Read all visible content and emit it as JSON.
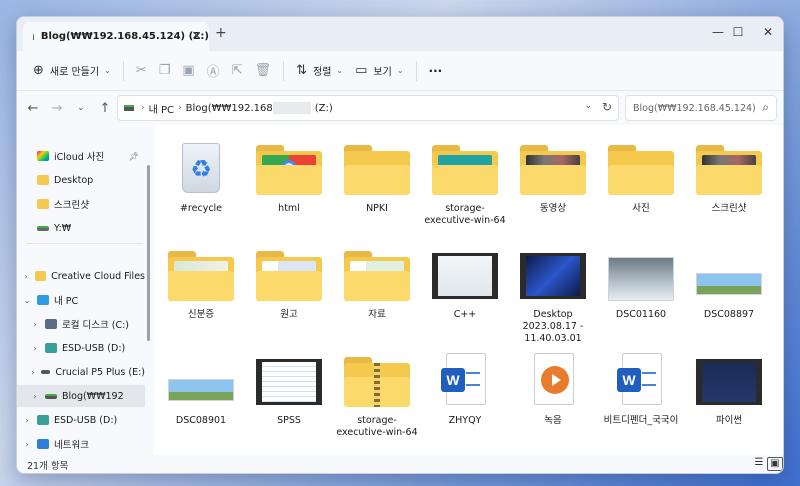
{
  "tab": {
    "title": "Blog(₩₩192.168.45.124) (Z:)",
    "close": "✕",
    "new_tab": "+"
  },
  "window_controls": {
    "minimize": "—",
    "maximize": "☐",
    "close": "✕"
  },
  "toolbar": {
    "new_label": "새로 만들기",
    "sort_label": "정렬",
    "view_label": "보기",
    "more": "···"
  },
  "address": {
    "segments": [
      "내 PC",
      "Blog(₩₩192.168",
      "(Z:)"
    ]
  },
  "search": {
    "placeholder": "Blog(₩₩192.168.45.124) (..."
  },
  "sidebar": {
    "quick": [
      "iCloud 사진",
      "Desktop",
      "스크린샷",
      "Y:₩"
    ],
    "tree": [
      "Creative Cloud Files",
      "내 PC",
      "로컬 디스크 (C:)",
      "ESD-USB (D:)",
      "Crucial P5 Plus (E:)",
      "Blog(₩₩192",
      "ESD-USB (D:)",
      "네트워크"
    ]
  },
  "items": [
    {
      "label": "#recycle",
      "kind": "recycle"
    },
    {
      "label": "html",
      "kind": "folder",
      "preview": "chrome"
    },
    {
      "label": "NPKI",
      "kind": "folder"
    },
    {
      "label": "storage-executive-win-64",
      "kind": "folder",
      "preview": "app"
    },
    {
      "label": "동영상",
      "kind": "folder",
      "preview": "dark"
    },
    {
      "label": "사진",
      "kind": "folder"
    },
    {
      "label": "스크린샷",
      "kind": "folder",
      "preview": "dark"
    },
    {
      "label": "신분증",
      "kind": "folder",
      "preview": "card"
    },
    {
      "label": "원고",
      "kind": "folder",
      "preview": "word"
    },
    {
      "label": "자료",
      "kind": "folder",
      "preview": "excel"
    },
    {
      "label": "C++",
      "kind": "video",
      "preview": "light"
    },
    {
      "label": "Desktop 2023.08.17 - 11.40.03.01",
      "kind": "video",
      "preview": "desktop"
    },
    {
      "label": "DSC01160",
      "kind": "photo",
      "preview": "keyboard"
    },
    {
      "label": "DSC08897",
      "kind": "photo",
      "preview": "sky"
    },
    {
      "label": "DSC08901",
      "kind": "photo",
      "preview": "sky"
    },
    {
      "label": "SPSS",
      "kind": "video",
      "preview": "sheet"
    },
    {
      "label": "storage-executive-win-64",
      "kind": "zip"
    },
    {
      "label": "ZHYQY",
      "kind": "word"
    },
    {
      "label": "녹음",
      "kind": "audio"
    },
    {
      "label": "비트디펜더_국국이",
      "kind": "word"
    },
    {
      "label": "파이썬",
      "kind": "video",
      "preview": "navy"
    }
  ],
  "status": {
    "count": "21개 항목"
  },
  "colors": {
    "accent": "#1f5dbe",
    "folder": "#f5c94d",
    "selection": "#e3e6ea"
  }
}
